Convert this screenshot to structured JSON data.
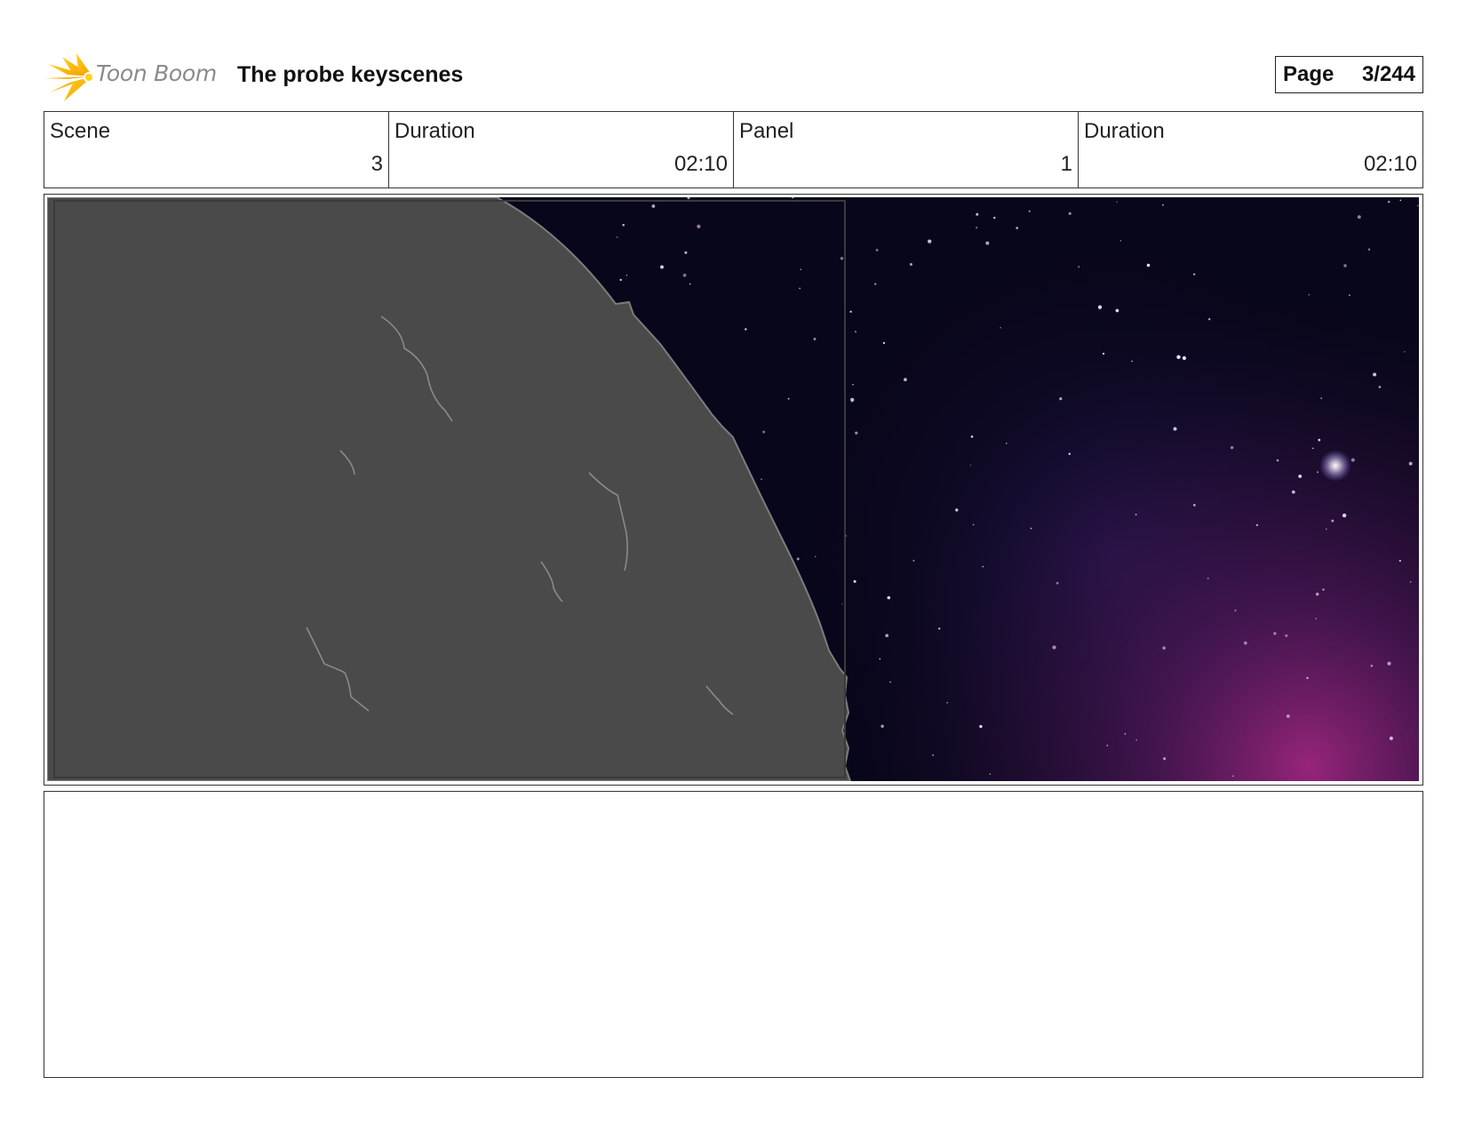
{
  "header": {
    "logo_text": "Toon Boom",
    "title": "The probe keyscenes",
    "page_label": "Page",
    "page_value": "3/244"
  },
  "info": {
    "scene_label": "Scene",
    "scene_value": "3",
    "scene_duration_label": "Duration",
    "scene_duration_value": "02:10",
    "panel_label": "Panel",
    "panel_value": "1",
    "panel_duration_label": "Duration",
    "panel_duration_value": "02:10"
  },
  "panel": {
    "image_subject": "planet-surface-against-starfield",
    "colors": {
      "planet": "#4a4a4a",
      "space": "#08061a",
      "nebula": "#6a1e6e"
    }
  },
  "notes": {
    "text": ""
  }
}
